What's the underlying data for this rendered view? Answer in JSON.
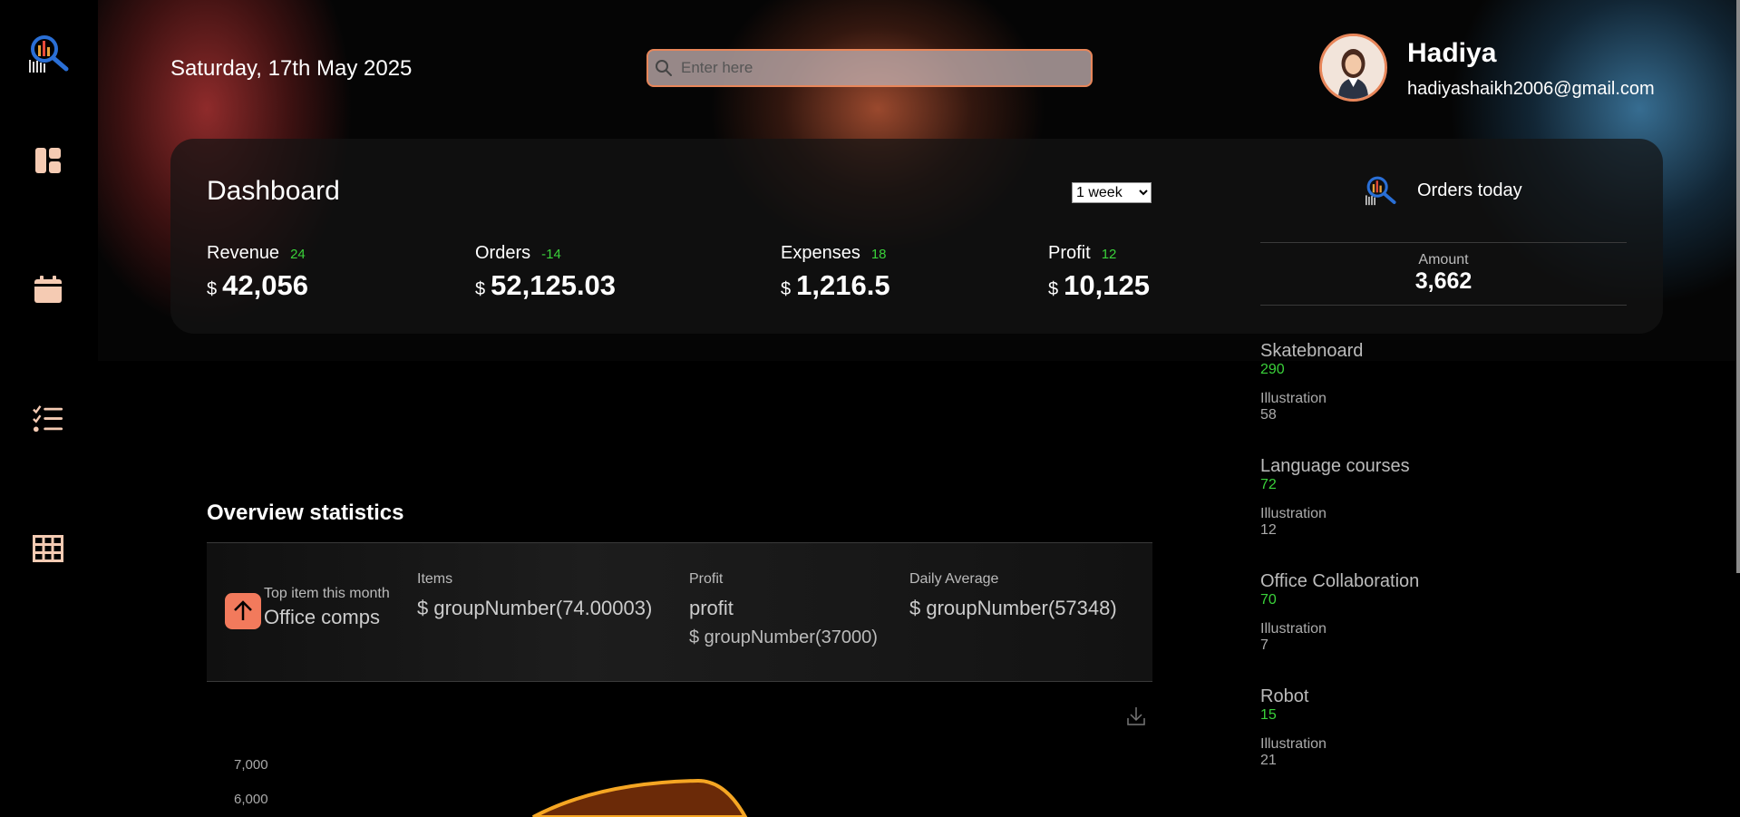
{
  "header": {
    "date": "Saturday, 17th May 2025",
    "search_placeholder": "Enter here",
    "user": {
      "name": "Hadiya",
      "email": "hadiyashaikh2006@gmail.com"
    }
  },
  "sidebar": {
    "icons": [
      "logo-icon",
      "dashboard-icon",
      "calendar-icon",
      "checklist-icon",
      "table-icon"
    ]
  },
  "dashboard": {
    "title": "Dashboard",
    "period": "1 week",
    "period_options": [
      "1 week"
    ],
    "metrics": [
      {
        "label": "Revenue",
        "delta": "24",
        "currency": "$",
        "value": "42,056"
      },
      {
        "label": "Orders",
        "delta": "-14",
        "currency": "$",
        "value": "52,125.03"
      },
      {
        "label": "Expenses",
        "delta": "18",
        "currency": "$",
        "value": "1,216.5"
      },
      {
        "label": "Profit",
        "delta": "12",
        "currency": "$",
        "value": "10,125"
      }
    ]
  },
  "orders_today": {
    "title": "Orders today",
    "amount_label": "Amount",
    "amount_value": "3,662",
    "items": [
      {
        "name": "Skatebnoard",
        "value": "290",
        "sub_label": "Illustration",
        "sub_value": "58"
      },
      {
        "name": "Language courses",
        "value": "72",
        "sub_label": "Illustration",
        "sub_value": "12"
      },
      {
        "name": "Office Collaboration",
        "value": "70",
        "sub_label": "Illustration",
        "sub_value": "7"
      },
      {
        "name": "Robot",
        "value": "15",
        "sub_label": "Illustration",
        "sub_value": "21"
      }
    ]
  },
  "overview": {
    "title": "Overview statistics",
    "top_item_label": "Top item this month",
    "top_item_value": "Office comps",
    "items_label": "Items",
    "items_value": "$ groupNumber(74.00003)",
    "profit_label": "Profit",
    "profit_value": "profit",
    "profit_sub": "$ groupNumber(37000)",
    "daily_label": "Daily Average",
    "daily_value": "$ groupNumber(57348)"
  },
  "chart_data": {
    "type": "area",
    "y_ticks": [
      "7,000",
      "6,000"
    ],
    "series_color": "#f5a623"
  },
  "colors": {
    "accent": "#e8865a",
    "positive": "#3ad13a",
    "icon": "#f5cbb3"
  }
}
